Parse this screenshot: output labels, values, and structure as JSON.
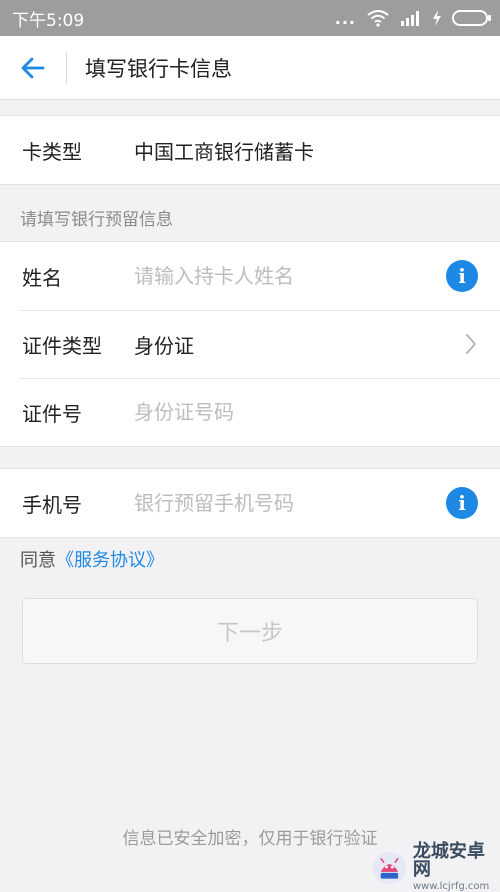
{
  "status_bar": {
    "time": "下午5:09",
    "dots": "..."
  },
  "header": {
    "title": "填写银行卡信息",
    "back_icon": "arrow-left-icon"
  },
  "card_section": {
    "label": "卡类型",
    "value": "中国工商银行储蓄卡"
  },
  "reserved_hint": "请填写银行预留信息",
  "form": {
    "name_label": "姓名",
    "name_placeholder": "请输入持卡人姓名",
    "id_type_label": "证件类型",
    "id_type_value": "身份证",
    "id_number_label": "证件号",
    "id_number_placeholder": "身份证号码"
  },
  "phone_section": {
    "label": "手机号",
    "placeholder": "银行预留手机号码"
  },
  "agreement": {
    "prefix": "同意",
    "link": "《服务协议》"
  },
  "next_button": "下一步",
  "footer": "信息已安全加密，仅用于银行验证",
  "watermark": {
    "main": "龙城安卓网",
    "sub": "www.lcjrfg.com"
  },
  "colors": {
    "accent": "#1e88e5",
    "status_bar": "#9d9d9d"
  }
}
